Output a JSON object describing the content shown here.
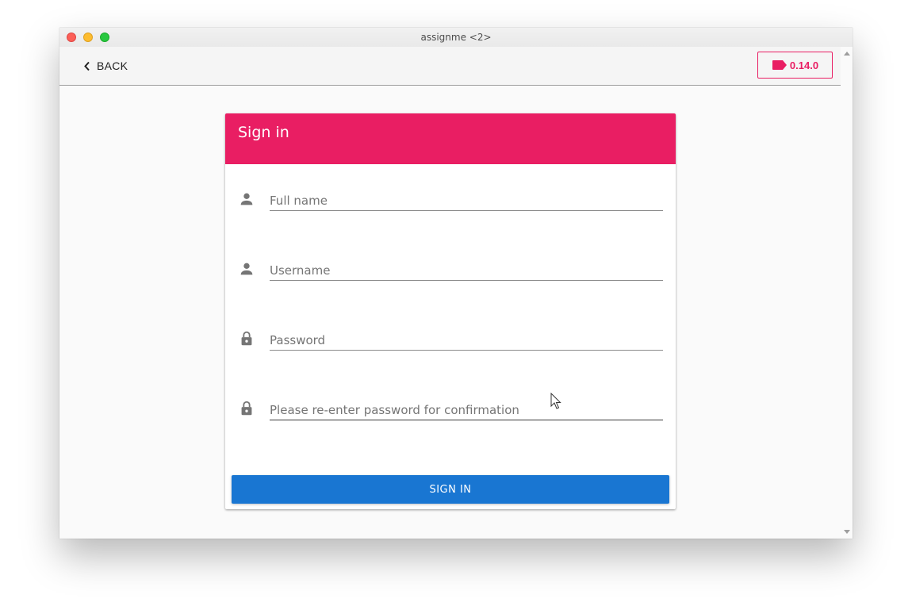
{
  "window": {
    "title": "assignme <2>"
  },
  "appbar": {
    "back_label": "BACK",
    "version_label": "0.14.0"
  },
  "form": {
    "title": "Sign in",
    "fields": [
      {
        "placeholder": "Full name",
        "icon": "person-icon",
        "value": ""
      },
      {
        "placeholder": "Username",
        "icon": "person-icon",
        "value": ""
      },
      {
        "placeholder": "Password",
        "icon": "lock-icon",
        "value": ""
      },
      {
        "placeholder": "Please re-enter password for confirmation",
        "icon": "lock-icon",
        "value": ""
      }
    ],
    "submit_label": "SIGN IN"
  },
  "colors": {
    "primary": "#e91e63",
    "button": "#1976d2",
    "background": "#fafafa"
  }
}
